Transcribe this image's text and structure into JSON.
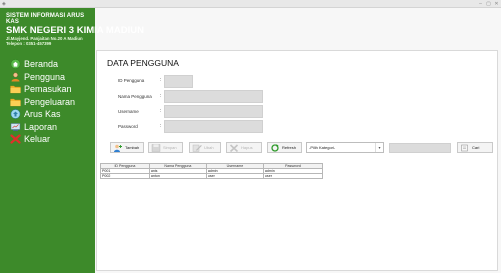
{
  "window": {
    "minimize_glyph": "–",
    "maximize_glyph": "▢",
    "close_glyph": "✕"
  },
  "sidebar": {
    "header": {
      "line1": "SISTEM INFORMASI ARUS KAS",
      "line2": "SMK NEGERI 3 KIMIA MADIUN",
      "line3": "Jl.Mayjend. Panjaitan No.20 A Madiun",
      "line4": "Telepon : 0351-457399"
    },
    "items": [
      {
        "label": "Beranda",
        "icon": "home-icon"
      },
      {
        "label": "Pengguna",
        "icon": "user-icon"
      },
      {
        "label": "Pemasukan",
        "icon": "folder-icon"
      },
      {
        "label": "Pengeluaran",
        "icon": "folder-icon"
      },
      {
        "label": "Arus Kas",
        "icon": "cashflow-icon"
      },
      {
        "label": "Laporan",
        "icon": "report-icon"
      },
      {
        "label": "Keluar",
        "icon": "exit-icon"
      }
    ]
  },
  "main": {
    "title": "DATA PENGGUNA",
    "form": {
      "id_label": "ID Pengguna",
      "nama_label": "Nama Pengguna",
      "username_label": "Username",
      "password_label": "Password",
      "colon": ":"
    },
    "toolbar": {
      "tambah": "Tambah",
      "simpan": "Simpan",
      "ubah": "Ubah",
      "hapus": "Hapus",
      "refresh": "Refresh",
      "kategori_selected": "-Pilih Kategori-",
      "cari": "Cari"
    },
    "table": {
      "columns": [
        "ID Pengguna",
        "Nama Pengguna",
        "Username",
        "Password"
      ],
      "rows": [
        [
          "P001",
          "anis",
          "admin",
          "admin"
        ],
        [
          "P002",
          "anton",
          "user",
          "user"
        ]
      ]
    }
  },
  "colors": {
    "sidebar_bg": "#3d8a2a",
    "accent_green": "#2e7d1d"
  }
}
